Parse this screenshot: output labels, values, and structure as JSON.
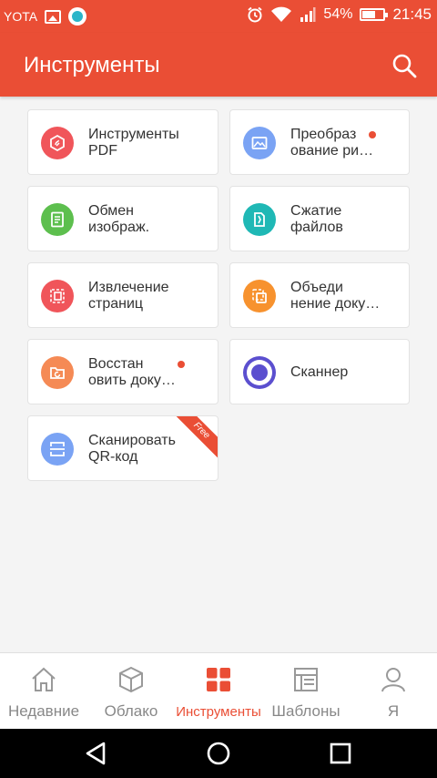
{
  "status_bar": {
    "carrier": "YOTA",
    "battery": "54%",
    "time": "21:45"
  },
  "appbar": {
    "title": "Инструменты"
  },
  "tools": [
    {
      "label": "Инструменты\nPDF",
      "icon": "pdf-tools-icon",
      "color": "#f0555a",
      "dot": false
    },
    {
      "label": "Преобраз\nование ри…",
      "icon": "image-convert-icon",
      "color": "#7aa3f4",
      "dot": true
    },
    {
      "label": "Обмен\nизображ.",
      "icon": "image-exchange-icon",
      "color": "#5dbf4e",
      "dot": false
    },
    {
      "label": "Сжатие\nфайлов",
      "icon": "compress-icon",
      "color": "#1fb8b5",
      "dot": false
    },
    {
      "label": "Извлечение\nстраниц",
      "icon": "extract-pages-icon",
      "color": "#f0555a",
      "dot": false
    },
    {
      "label": "Объеди\nнение доку…",
      "icon": "merge-docs-icon",
      "color": "#f7922e",
      "dot": false
    },
    {
      "label": "Восстан\nовить доку…",
      "icon": "restore-docs-icon",
      "color": "#f58a55",
      "dot": true
    },
    {
      "label": "Сканнер",
      "icon": "scanner-icon",
      "color": "#5b4fcf",
      "dot": false
    },
    {
      "label": "Сканировать\nQR-код",
      "icon": "qr-scan-icon",
      "color": "#7aa3f4",
      "dot": false,
      "ribbon": "Free"
    }
  ],
  "nav": {
    "items": [
      {
        "label": "Недавние",
        "icon": "home-icon"
      },
      {
        "label": "Облако",
        "icon": "cloud-box-icon"
      },
      {
        "label": "Инструменты",
        "icon": "tools-grid-icon",
        "active": true
      },
      {
        "label": "Шаблоны",
        "icon": "templates-icon"
      },
      {
        "label": "Я",
        "icon": "profile-icon"
      }
    ]
  },
  "colors": {
    "accent": "#ea4e35",
    "background": "#f4f4f4"
  }
}
